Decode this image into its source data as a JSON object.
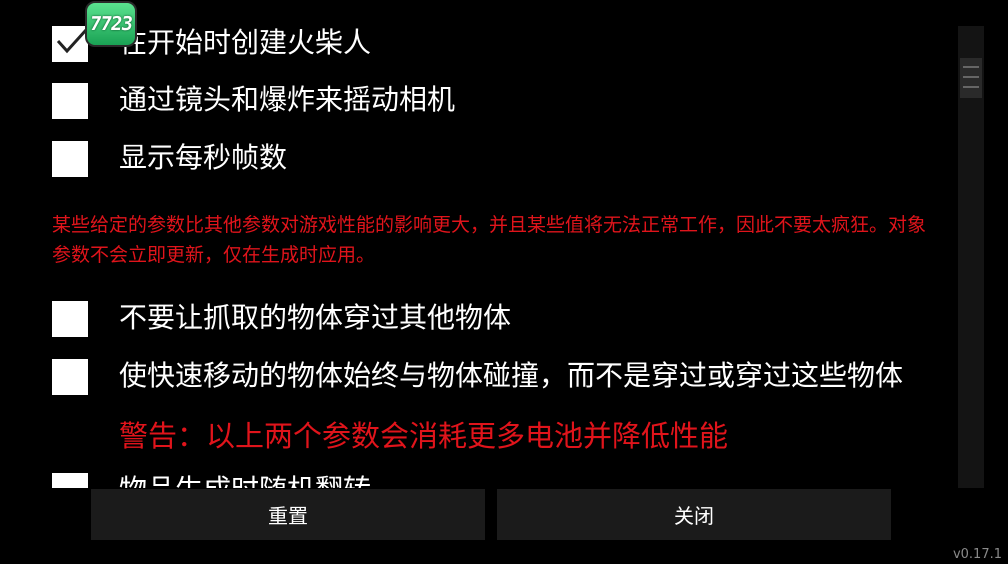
{
  "options": [
    {
      "label": "在开始时创建火柴人",
      "checked": true
    },
    {
      "label": "通过镜头和爆炸来摇动相机",
      "checked": false
    },
    {
      "label": "显示每秒帧数",
      "checked": false
    },
    {
      "label": "不要让抓取的物体穿过其他物体",
      "checked": false
    },
    {
      "label": "使快速移动的物体始终与物体碰撞，而不是穿过或穿过这些物体",
      "checked": false
    },
    {
      "label": "物品生成时随机翻转",
      "checked": false
    }
  ],
  "note": "某些给定的参数比其他参数对游戏性能的影响更大，并且某些值将无法正常工作，因此不要太疯狂。对象参数不会立即更新，仅在生成时应用。",
  "warning": "警告：以上两个参数会消耗更多电池并降低性能",
  "buttons": {
    "reset": "重置",
    "close": "关闭"
  },
  "version": "v0.17.1",
  "badge": "7723",
  "icons": {
    "check": "check-icon"
  },
  "colors": {
    "warning": "#e0141b",
    "background": "#000000",
    "badge": "#2ecc71"
  }
}
